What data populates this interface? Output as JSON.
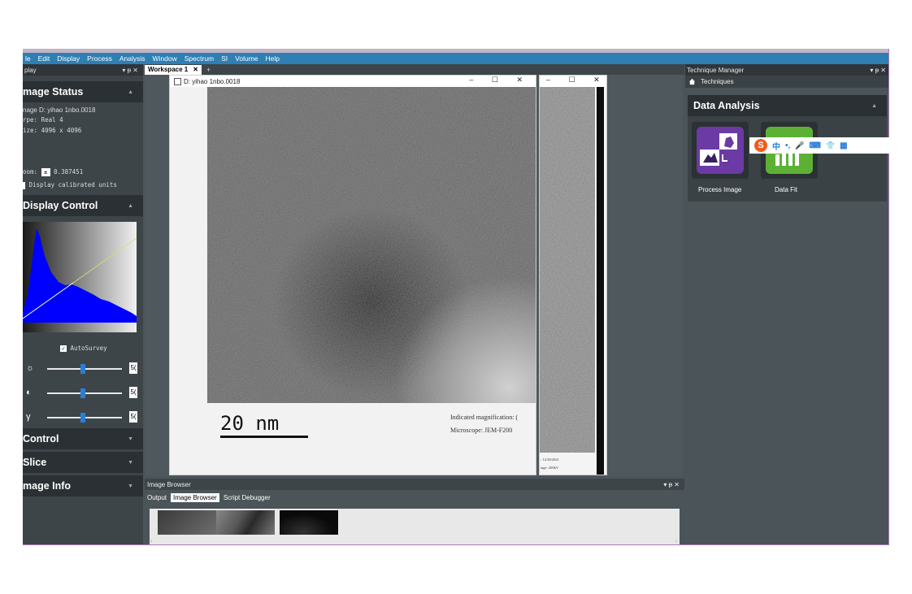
{
  "menubar": {
    "items": [
      "le",
      "Edit",
      "Display",
      "Process",
      "Analysis",
      "Window",
      "Spectrum",
      "SI",
      "Volume",
      "Help"
    ]
  },
  "left_panel": {
    "title": "play",
    "controls": "▾ ᵽ ✕",
    "image_status": {
      "header": "mage Status",
      "name_line": "nage D: yihao 1nbo.0018",
      "type_line": "rpe: Real 4",
      "size_line": "ize: 4096 x 4096",
      "zoom_prefix": "oom:",
      "zoom_value": "0.387451",
      "calibrated_label": "Display calibrated units"
    },
    "display_control": {
      "header": "Display Control",
      "autosurvey_label": "AutoSurvey",
      "brightness_value": "5(",
      "contrast_value": "5(",
      "gamma_value": "5("
    },
    "sections": {
      "control": "Control",
      "slice": "Slice",
      "image_info": "mage Info"
    }
  },
  "workspace": {
    "tab_label": "Workspace 1",
    "tab_close": "✕",
    "tab_add": "+",
    "image_window": {
      "title": "D: yihao 1nbo.0018",
      "controls": "– ☐ ✕",
      "scalebar_label": "20 nm",
      "magnification_line": "Indicated magnification: (",
      "microscope_line": "Microscope: JEM-F200"
    },
    "second_window": {
      "controls": "– ☐ ✕",
      "date_line": ": 12/28/2021",
      "voltage_line": "tage: 200kV"
    }
  },
  "image_browser": {
    "title": "Image Browser",
    "controls": "▾ ᵽ ✕",
    "tabs": [
      "Output",
      "Image Browser",
      "Script Debugger"
    ],
    "active_tab": 1,
    "nav_left": "‹",
    "nav_right": "›"
  },
  "technique_manager": {
    "title": "Technique Manager",
    "controls": "▾ ᵽ ✕",
    "breadcrumb": "Techniques",
    "section_header": "Data Analysis",
    "tools": [
      {
        "label": "Process Image",
        "icon": "process-image-icon",
        "color": "#6b3aa5"
      },
      {
        "label": "Data Fit",
        "icon": "data-fit-icon",
        "color": "#5cb135"
      }
    ]
  },
  "ime_toolbar": {
    "items": [
      "S",
      "中",
      "•,",
      "🎤",
      "⌨",
      "👕",
      "▦"
    ]
  },
  "colors": {
    "menubar": "#2e7fb3",
    "histogram_fill": "#0000ff",
    "slider_thumb": "#2a7ed3",
    "panel_bg": "#3d4549"
  }
}
